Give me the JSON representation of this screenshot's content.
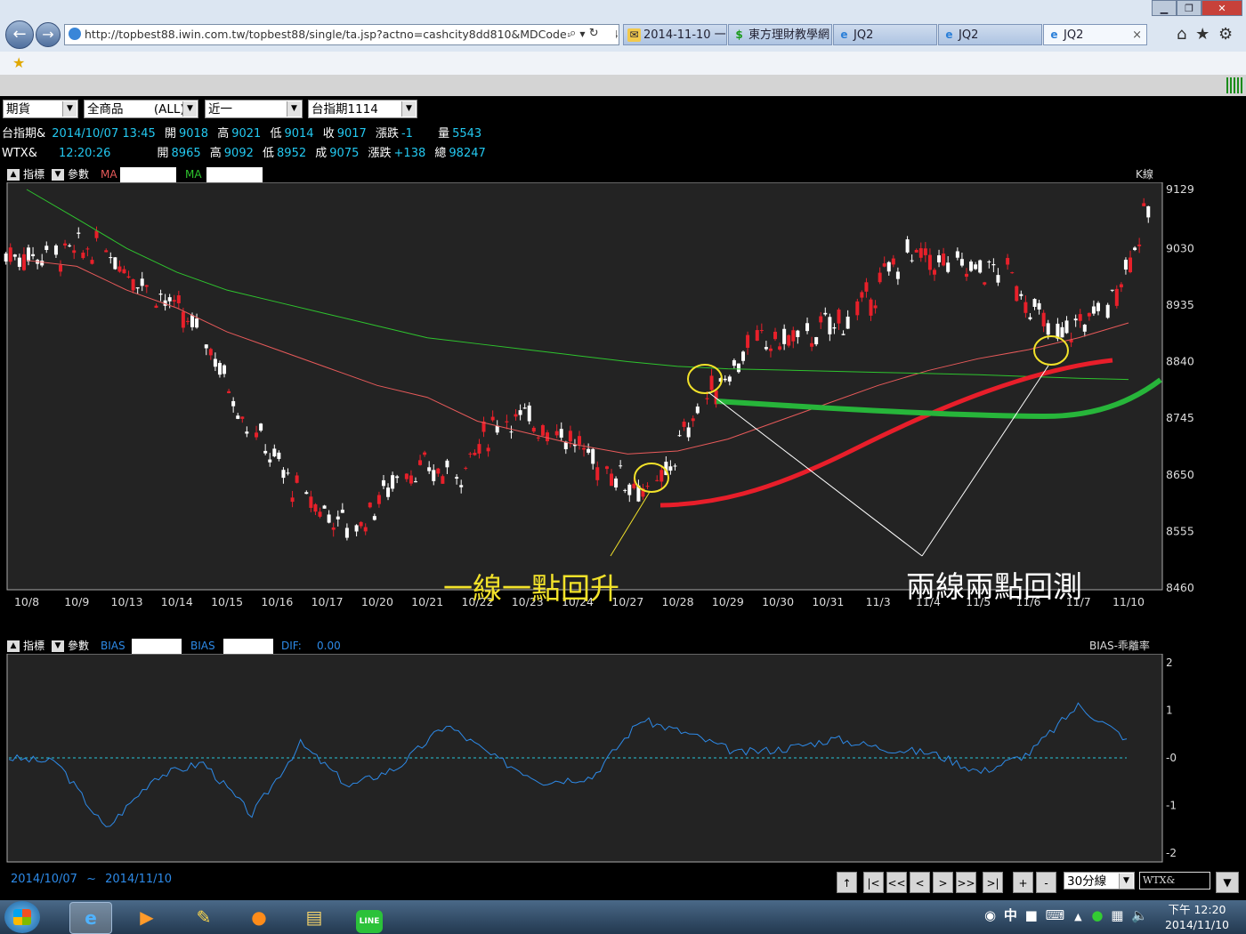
{
  "browser": {
    "address": "http://topbest88.iwin.com.tw/topbest88/single/ta.jsp?actno=cashcity8dd810&MDCode=8e5154",
    "tabs": [
      {
        "label": "2014-11-10 一...",
        "icon": "mail-icon",
        "active": false
      },
      {
        "label": "東方理財教學網",
        "icon": "dollar-icon",
        "active": false
      },
      {
        "label": "JQ2",
        "icon": "ie-icon",
        "active": false
      },
      {
        "label": "JQ2",
        "icon": "ie-icon",
        "active": false
      },
      {
        "label": "JQ2",
        "icon": "ie-icon",
        "active": true
      }
    ],
    "close_tab_label": "×"
  },
  "controls": {
    "selects": [
      "期貨",
      "全商品        (ALL)",
      "近一",
      "台指期1114"
    ]
  },
  "quotes": {
    "row1": {
      "name": "台指期&",
      "time": "2014/10/07 13:45",
      "open_l": "開",
      "open": "9018",
      "high_l": "高",
      "high": "9021",
      "low_l": "低",
      "low": "9014",
      "close_l": "收",
      "close": "9017",
      "chg_l": "漲跌",
      "chg": "-1",
      "vol_l": "量",
      "vol": "5543"
    },
    "row2": {
      "name": "WTX&",
      "time": "12:20:26",
      "open_l": "開",
      "open": "8965",
      "high_l": "高",
      "high": "9092",
      "low_l": "低",
      "low": "8952",
      "close_l": "成",
      "close": "9075",
      "chg_l": "漲跌",
      "chg": "+138",
      "vol_l": "總",
      "vol": "98247"
    }
  },
  "main_panel": {
    "indicator_label": "指標",
    "param_label": "參數",
    "ma1_label": "MA",
    "ma2_label": "MA",
    "chart_kind": "K線"
  },
  "sub_panel": {
    "indicator_label": "指標",
    "param_label": "參數",
    "bias1_label": "BIAS",
    "bias2_label": "BIAS",
    "dif_label": "DIF:",
    "dif_value": "0.00",
    "chart_kind": "BIAS-乖離率"
  },
  "annotations": {
    "left_text": "一線一點回升",
    "right_text": "兩線兩點回測"
  },
  "chart_data": [
    {
      "type": "candlestick",
      "x_ticks": [
        "10/8",
        "10/9",
        "10/13",
        "10/14",
        "10/15",
        "10/16",
        "10/17",
        "10/20",
        "10/21",
        "10/22",
        "10/23",
        "10/24",
        "10/27",
        "10/28",
        "10/29",
        "10/30",
        "10/31",
        "11/3",
        "11/4",
        "11/5",
        "11/6",
        "11/7",
        "11/10"
      ],
      "y_ticks": [
        9129,
        9030,
        8935,
        8840,
        8745,
        8650,
        8555,
        8460
      ],
      "ylim": [
        8460,
        9129
      ],
      "series": [
        {
          "values": [
            9020,
            9030,
            8960,
            8880,
            8720,
            8610,
            8560,
            8660,
            8650,
            8750,
            8730,
            8660,
            8620,
            8780,
            8870,
            8880,
            8920,
            9020,
            9000,
            8990,
            8880,
            8930,
            9110
          ]
        },
        {
          "values": [
            9010,
            9000,
            8960,
            8930,
            8890,
            8860,
            8830,
            8800,
            8780,
            8740,
            8720,
            8700,
            8685,
            8690,
            8710,
            8740,
            8770,
            8800,
            8825,
            8845,
            8860,
            8880,
            8905
          ]
        },
        {
          "values": [
            9129,
            9080,
            9030,
            8990,
            8960,
            8940,
            8920,
            8900,
            8880,
            8870,
            8860,
            8850,
            8840,
            8832,
            8828,
            8826,
            8824,
            8822,
            8820,
            8818,
            8815,
            8812,
            8810
          ]
        }
      ]
    },
    {
      "type": "line",
      "y_ticks": [
        "2",
        "1",
        "-0",
        "-1",
        "-2"
      ],
      "ylim": [
        -2,
        2
      ],
      "series": [
        {
          "values": [
            0.0,
            -0.1,
            -1.5,
            -0.4,
            -0.1,
            -1.2,
            0.3,
            -0.6,
            -0.2,
            0.7,
            0.0,
            -0.5,
            -0.4,
            0.8,
            0.5,
            0.1,
            0.2,
            0.4,
            0.2,
            0.1,
            -0.3,
            0.1,
            1.1,
            0.4
          ]
        }
      ]
    }
  ],
  "range": {
    "from": "2014/10/07",
    "sep": "~",
    "to": "2014/11/10"
  },
  "toolbar": {
    "buttons": [
      "↑",
      "|<",
      "<<",
      "<",
      ">",
      ">>",
      ">|",
      "+",
      "-"
    ],
    "period": "30分線",
    "symbol": "WTX&"
  },
  "taskbar": {
    "ime": "中",
    "time": "下午 12:20",
    "date": "2014/11/10"
  },
  "colors": {
    "up": "#e8202a",
    "down": "#ffffff",
    "ma_short": "#e85a5a",
    "ma_long": "#2ec42e",
    "bias": "#2d8ae8",
    "quote_value": "#23c8f0",
    "annotation_left": "#f2e22a"
  }
}
